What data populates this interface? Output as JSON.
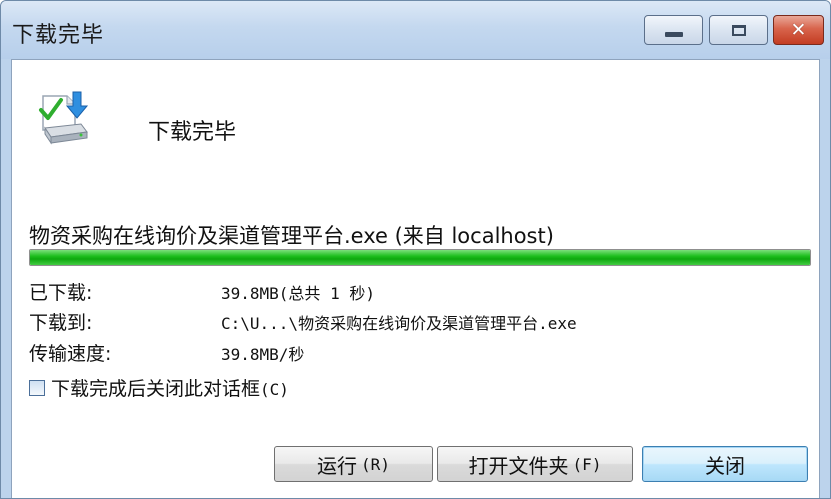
{
  "window": {
    "title": "下载完毕",
    "controls": {
      "minimize": "minimize",
      "maximize": "maximize",
      "close": "✕"
    }
  },
  "header": {
    "icon": "download-complete-icon",
    "text": "下载完毕"
  },
  "download": {
    "filename_line": "物资采购在线询价及渠道管理平台.exe (来自 localhost)",
    "progress_percent": 100,
    "progress_color": "#1fbf1f",
    "rows": [
      {
        "label": "已下载:",
        "value": "39.8MB(总共 1 秒)"
      },
      {
        "label": "下载到:",
        "value": "C:\\U...\\物资采购在线询价及渠道管理平台.exe"
      },
      {
        "label": "传输速度:",
        "value": "39.8MB/秒"
      }
    ]
  },
  "options": {
    "close_when_done_label": "下载完成后关闭此对话框",
    "close_when_done_hotkey": "(C)",
    "close_when_done_checked": false
  },
  "buttons": {
    "run_label": "运行",
    "run_hotkey": "(R)",
    "open_folder_label": "打开文件夹",
    "open_folder_hotkey": "(F)",
    "close_label": "关闭"
  }
}
